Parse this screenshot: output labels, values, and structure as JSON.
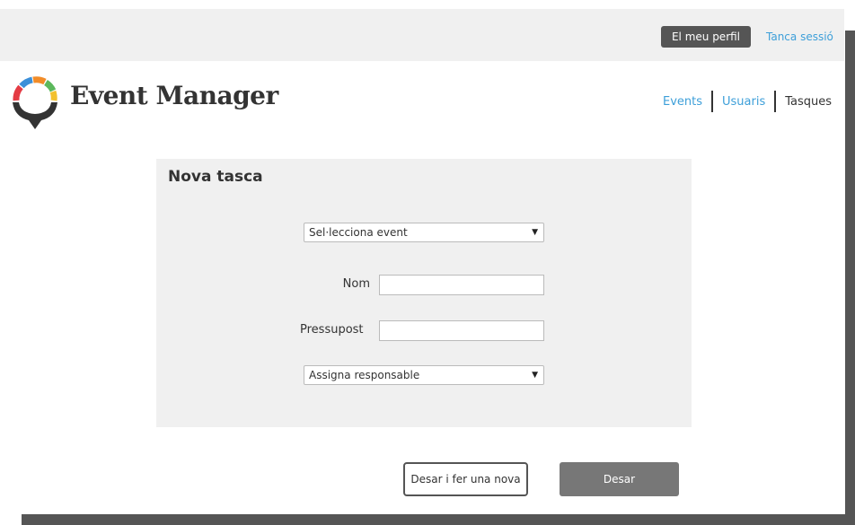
{
  "header": {
    "profile_label": "El meu perfil",
    "logout_label": "Tanca sessió"
  },
  "brand": {
    "name": "Event Manager"
  },
  "nav": {
    "items": [
      {
        "label": "Events",
        "active": false
      },
      {
        "label": "Usuaris",
        "active": false
      },
      {
        "label": "Tasques",
        "active": true
      }
    ]
  },
  "form": {
    "title": "Nova tasca",
    "event_select": {
      "selected": "Sel·lecciona event"
    },
    "name_label": "Nom",
    "name_value": "",
    "budget_label": "Pressupost",
    "budget_value": "",
    "owner_select": {
      "selected": "Assigna responsable"
    }
  },
  "actions": {
    "save_new_label": "Desar i fer una nova",
    "save_label": "Desar"
  },
  "colors": {
    "accent_link": "#3d9fd9",
    "dark_button": "#555555",
    "primary_button": "#777777",
    "panel_bg": "#f0f0f0"
  },
  "icons": {
    "logo": "map-pin-logo-icon",
    "dropdown": "dropdown-arrow-icon"
  }
}
